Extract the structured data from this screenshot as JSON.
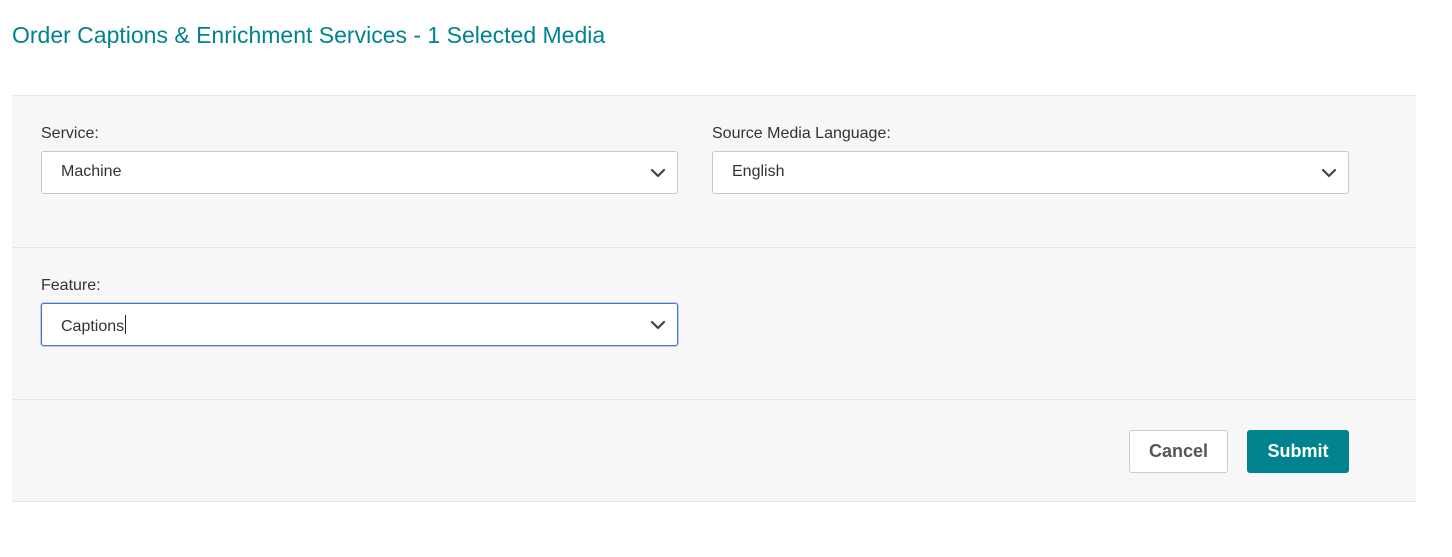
{
  "page": {
    "title": "Order Captions & Enrichment Services - 1 Selected Media"
  },
  "form": {
    "service": {
      "label": "Service:",
      "value": "Machine"
    },
    "source_language": {
      "label": "Source Media Language:",
      "value": "English"
    },
    "feature": {
      "label": "Feature:",
      "value": "Captions"
    }
  },
  "actions": {
    "cancel_label": "Cancel",
    "submit_label": "Submit"
  },
  "colors": {
    "accent": "#00838f",
    "panel_bg": "#f7f7f7",
    "focus_border": "#4a78c2"
  },
  "icons": {
    "dropdown": "chevron-down-icon"
  }
}
